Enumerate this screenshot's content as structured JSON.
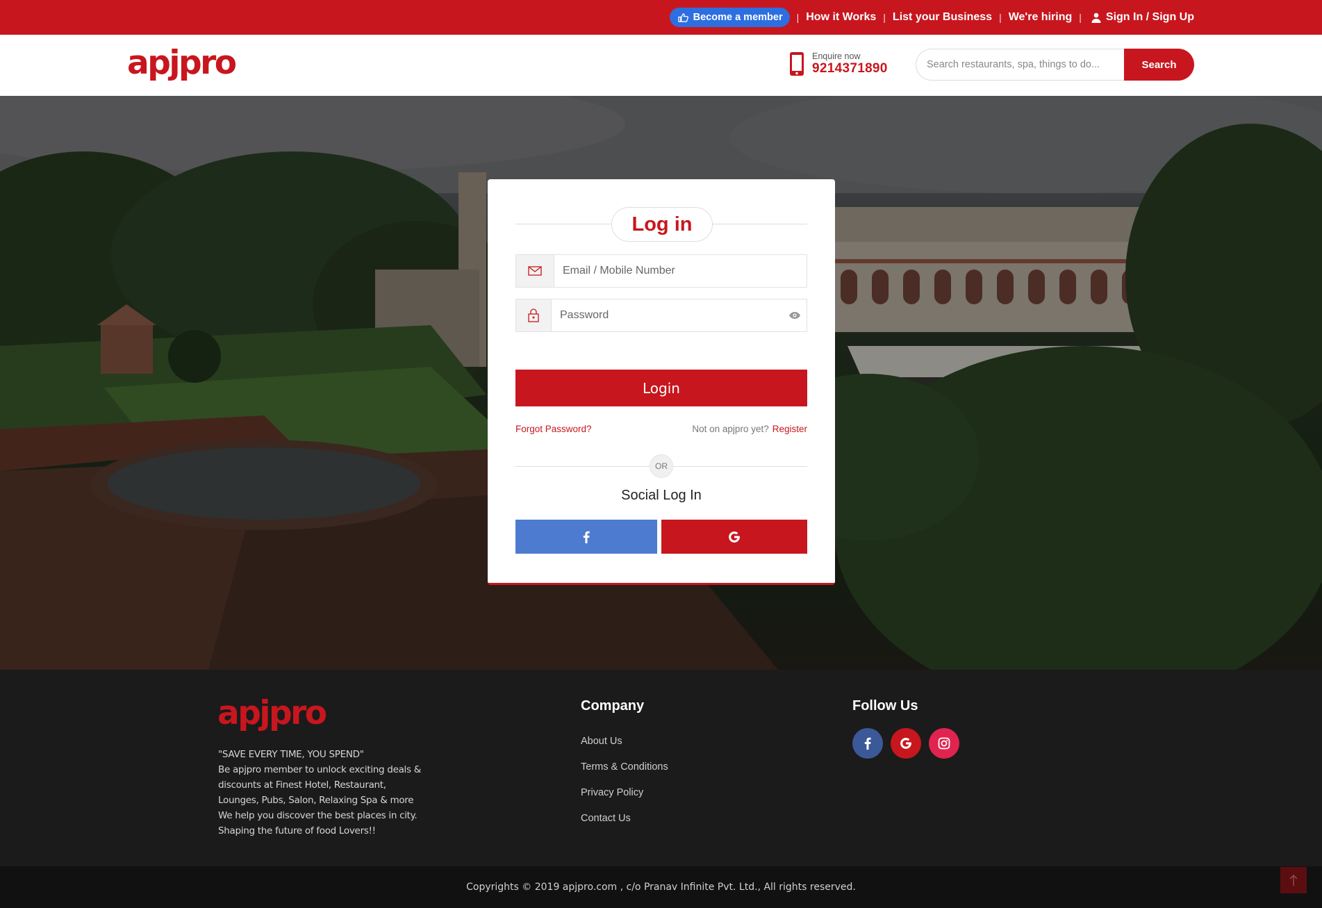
{
  "topbar": {
    "become_member": "Become a member",
    "how_it_works": "How it Works",
    "list_business": "List your Business",
    "hiring": "We're hiring",
    "signin": "Sign In / Sign Up",
    "separator": "|"
  },
  "header": {
    "logo": "apjpro",
    "enquire_label": "Enquire now",
    "enquire_phone": "9214371890",
    "search_placeholder": "Search restaurants, spa, things to do...",
    "search_button": "Search"
  },
  "login": {
    "title": "Log in",
    "email_placeholder": "Email / Mobile Number",
    "password_placeholder": "Password",
    "login_button": "Login",
    "forgot": "Forgot Password?",
    "not_on": "Not on apjpro yet?",
    "register": "Register",
    "or": "OR",
    "social_title": "Social Log In"
  },
  "footer": {
    "logo": "apjpro",
    "tagline": [
      "\"SAVE EVERY TIME, YOU SPEND\"",
      "Be apjpro member to unlock exciting deals &",
      "discounts at Finest Hotel, Restaurant,",
      "Lounges, Pubs, Salon, Relaxing Spa & more",
      "We help you discover the best places in city.",
      "Shaping the future of food Lovers!!"
    ],
    "company_title": "Company",
    "company_links": [
      "About Us",
      "Terms & Conditions",
      "Privacy Policy",
      "Contact Us"
    ],
    "follow_title": "Follow Us",
    "social_icons": [
      "facebook-icon",
      "google-icon",
      "instagram-icon"
    ],
    "copyright": "Copyrights © 2019 apjpro.com , c/o Pranav Infinite Pvt. Ltd., All rights reserved."
  },
  "colors": {
    "brand_red": "#c8161e",
    "member_blue": "#2d6fe0",
    "facebook_blue": "#4d7bd0",
    "footer_bg": "#1b1b1b"
  }
}
